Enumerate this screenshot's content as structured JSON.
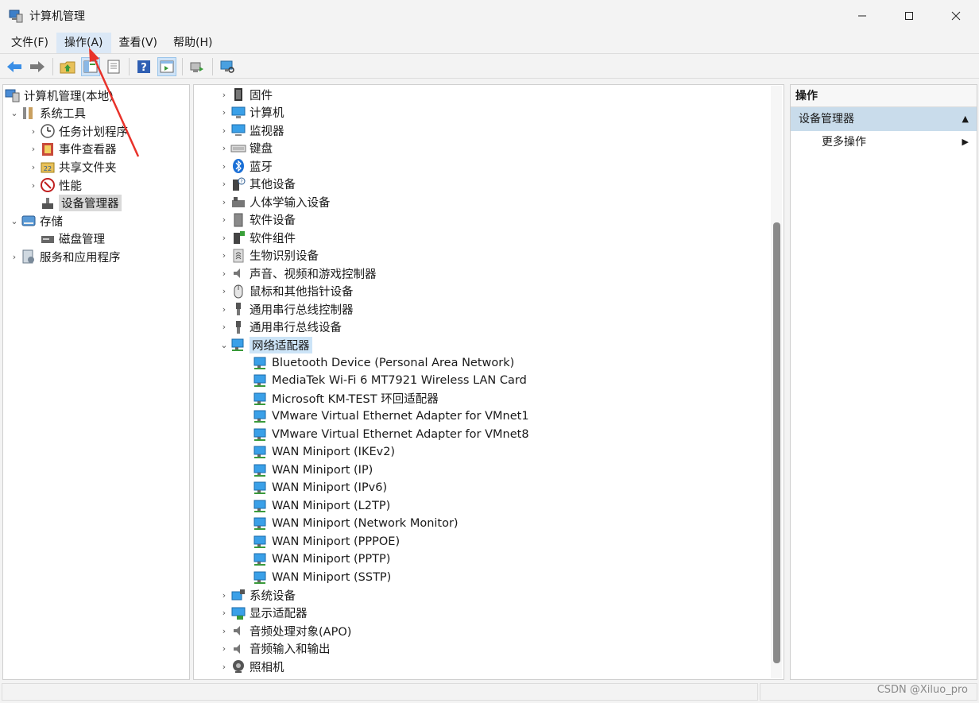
{
  "window": {
    "title": "计算机管理"
  },
  "menu": {
    "file": "文件(F)",
    "action": "操作(A)",
    "view": "查看(V)",
    "help": "帮助(H)"
  },
  "left_tree": [
    {
      "label": "计算机管理(本地)",
      "expander": "",
      "icon": "computer-management-icon",
      "depth": 0
    },
    {
      "label": "系统工具",
      "expander": "⌄",
      "icon": "system-tools-icon",
      "depth": 1
    },
    {
      "label": "任务计划程序",
      "expander": "›",
      "icon": "task-scheduler-icon",
      "depth": 2
    },
    {
      "label": "事件查看器",
      "expander": "›",
      "icon": "event-viewer-icon",
      "depth": 2
    },
    {
      "label": "共享文件夹",
      "expander": "›",
      "icon": "shared-folders-icon",
      "depth": 2
    },
    {
      "label": "性能",
      "expander": "›",
      "icon": "performance-icon",
      "depth": 2
    },
    {
      "label": "设备管理器",
      "expander": "",
      "icon": "device-manager-icon",
      "depth": 2,
      "selected": true
    },
    {
      "label": "存储",
      "expander": "⌄",
      "icon": "storage-icon",
      "depth": 1
    },
    {
      "label": "磁盘管理",
      "expander": "",
      "icon": "disk-management-icon",
      "depth": 2
    },
    {
      "label": "服务和应用程序",
      "expander": "›",
      "icon": "services-apps-icon",
      "depth": 1
    }
  ],
  "device_tree": {
    "categories_before": [
      {
        "label": "固件",
        "icon": "firmware-icon"
      },
      {
        "label": "计算机",
        "icon": "computer-icon"
      },
      {
        "label": "监视器",
        "icon": "monitor-icon"
      },
      {
        "label": "键盘",
        "icon": "keyboard-icon"
      },
      {
        "label": "蓝牙",
        "icon": "bluetooth-icon"
      },
      {
        "label": "其他设备",
        "icon": "other-devices-icon"
      },
      {
        "label": "人体学输入设备",
        "icon": "hid-icon"
      },
      {
        "label": "软件设备",
        "icon": "software-device-icon"
      },
      {
        "label": "软件组件",
        "icon": "software-component-icon"
      },
      {
        "label": "生物识别设备",
        "icon": "biometric-icon"
      },
      {
        "label": "声音、视频和游戏控制器",
        "icon": "sound-icon"
      },
      {
        "label": "鼠标和其他指针设备",
        "icon": "mouse-icon"
      },
      {
        "label": "通用串行总线控制器",
        "icon": "usb-icon"
      },
      {
        "label": "通用串行总线设备",
        "icon": "usb-icon"
      }
    ],
    "expanded_category": {
      "label": "网络适配器",
      "icon": "network-adapter-icon"
    },
    "network_adapters": [
      "Bluetooth Device (Personal Area Network)",
      "MediaTek Wi-Fi 6 MT7921 Wireless LAN Card",
      "Microsoft KM-TEST 环回适配器",
      "VMware Virtual Ethernet Adapter for VMnet1",
      "VMware Virtual Ethernet Adapter for VMnet8",
      "WAN Miniport (IKEv2)",
      "WAN Miniport (IP)",
      "WAN Miniport (IPv6)",
      "WAN Miniport (L2TP)",
      "WAN Miniport (Network Monitor)",
      "WAN Miniport (PPPOE)",
      "WAN Miniport (PPTP)",
      "WAN Miniport (SSTP)"
    ],
    "categories_after": [
      {
        "label": "系统设备",
        "icon": "system-devices-icon"
      },
      {
        "label": "显示适配器",
        "icon": "display-adapter-icon"
      },
      {
        "label": "音频处理对象(APO)",
        "icon": "audio-processing-icon"
      },
      {
        "label": "音频输入和输出",
        "icon": "audio-io-icon"
      },
      {
        "label": "照相机",
        "icon": "camera-icon"
      }
    ]
  },
  "actions_pane": {
    "header": "操作",
    "section": "设备管理器",
    "more": "更多操作"
  },
  "watermark": "CSDN @Xiluo_pro",
  "colors": {
    "accent": "#0078d4",
    "selection": "#cce4f7",
    "arrow": "#e8322a"
  }
}
